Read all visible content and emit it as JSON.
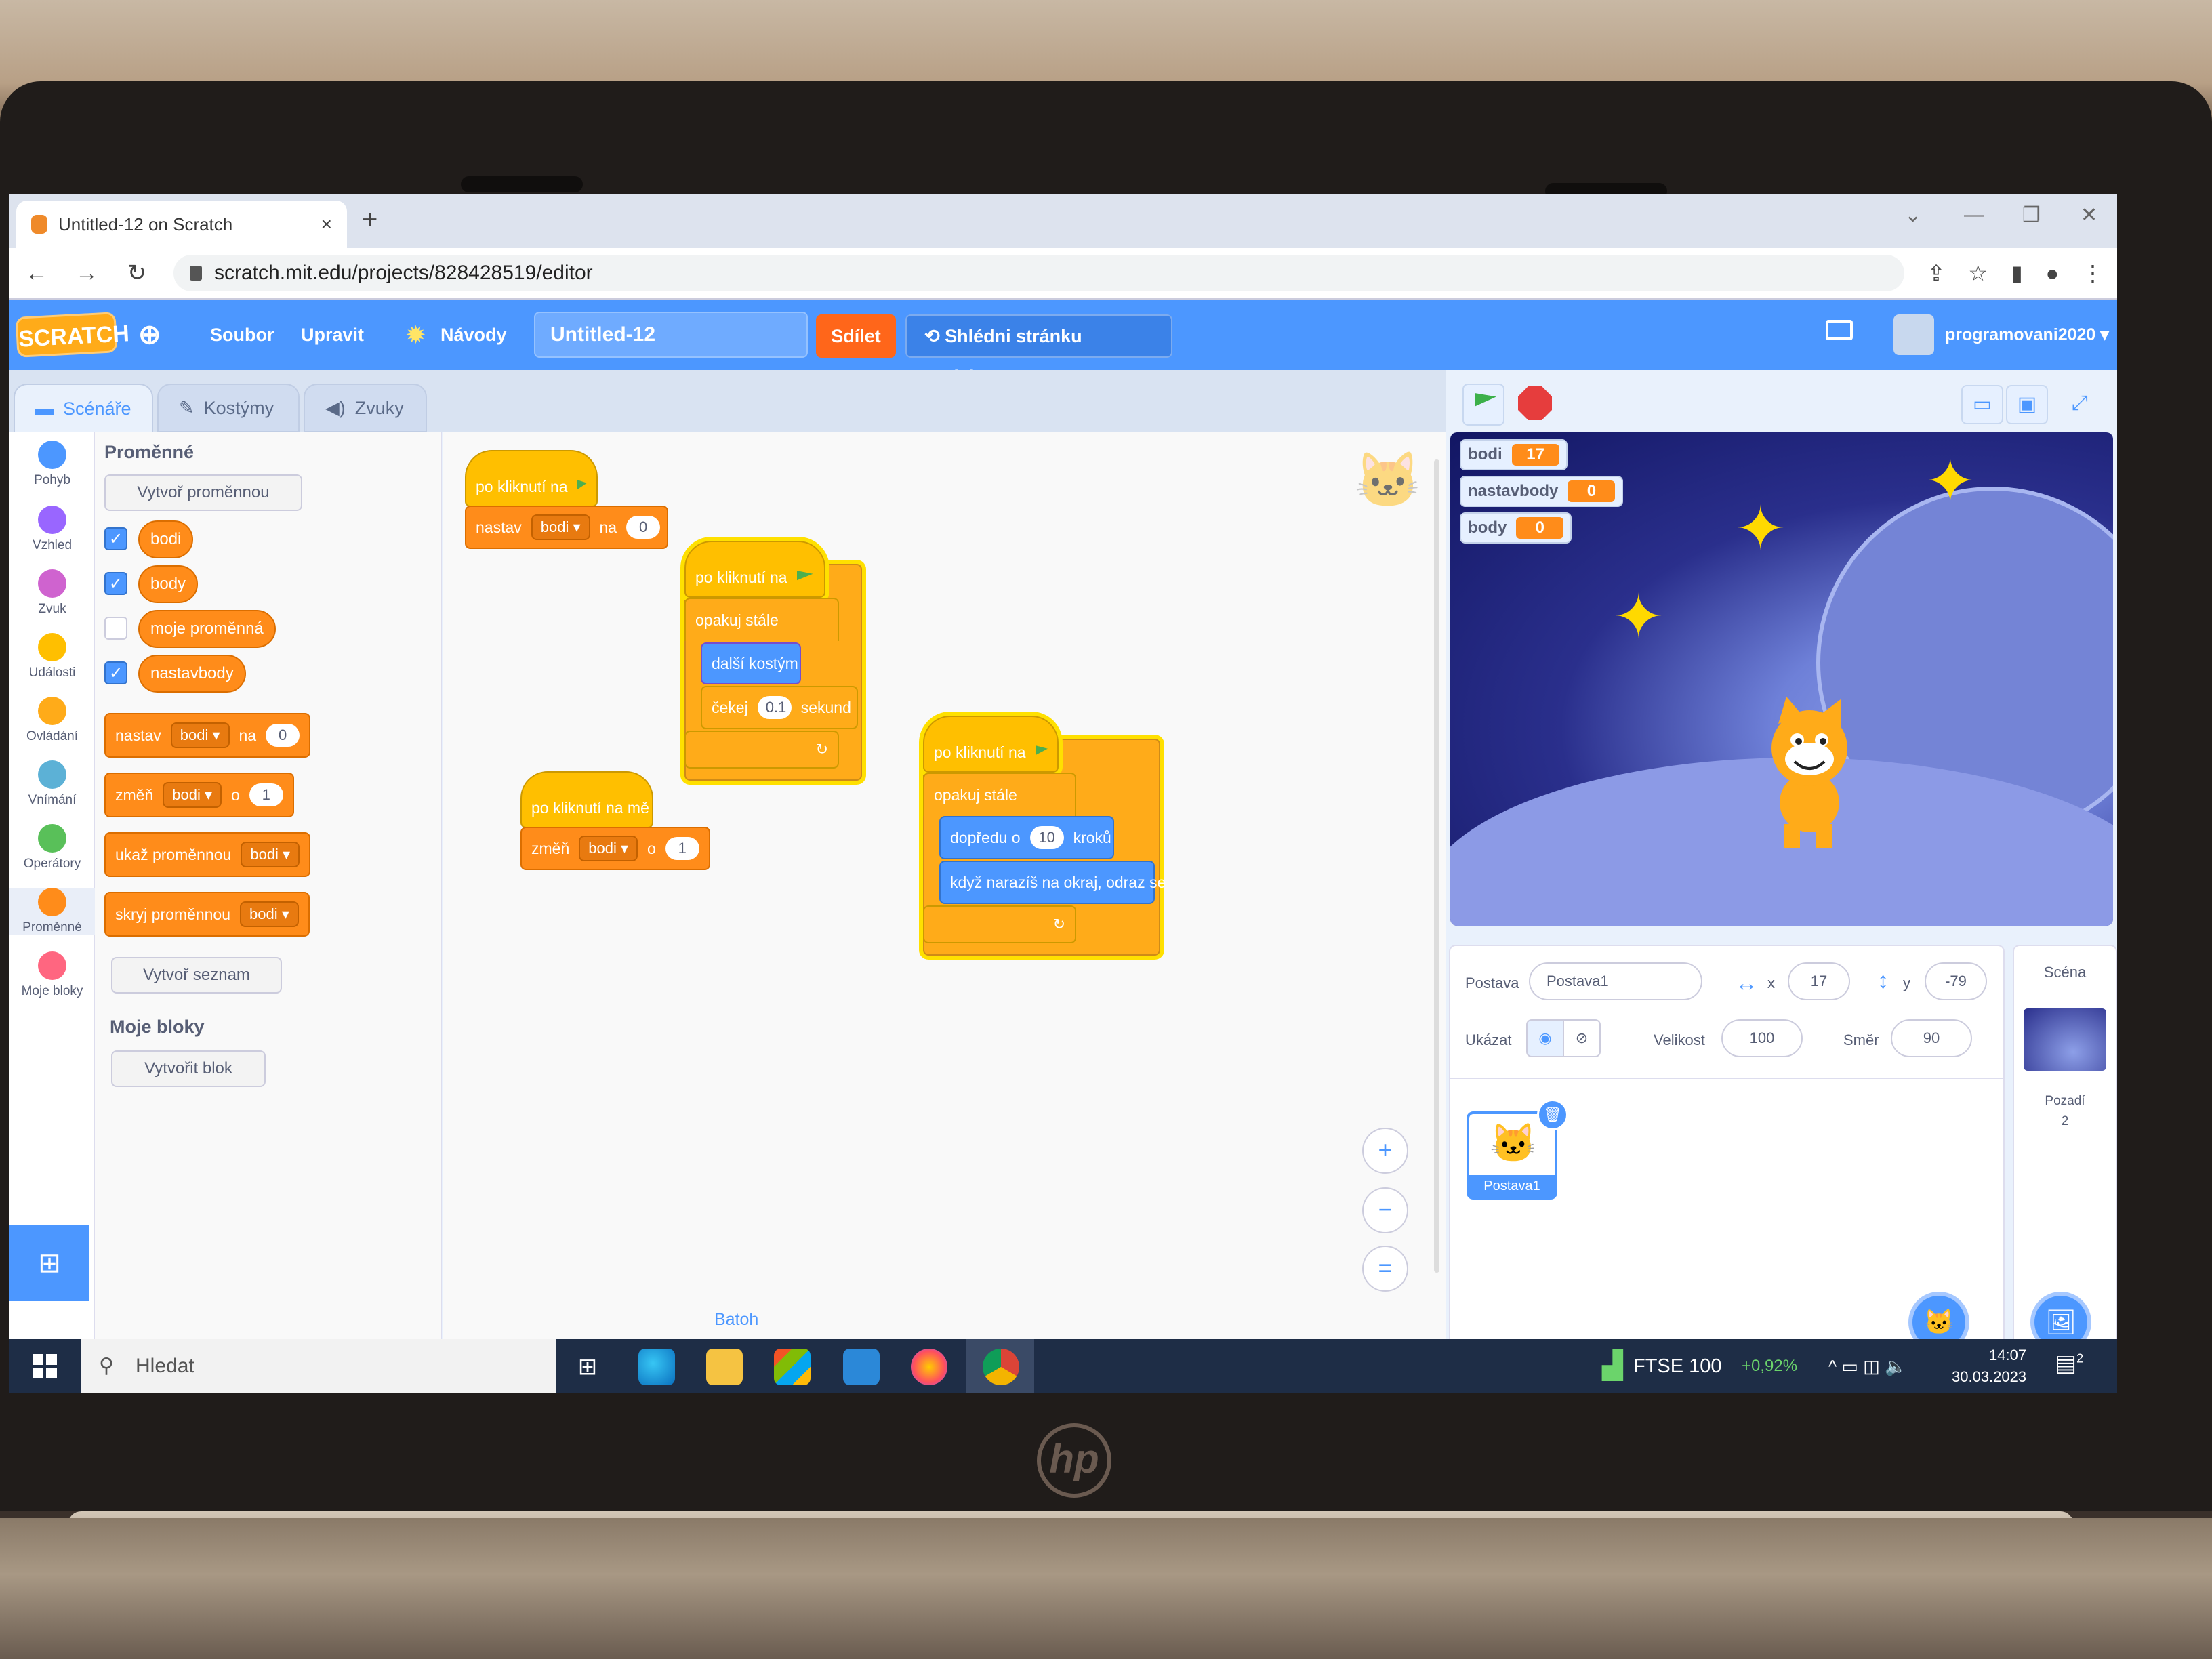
{
  "browser": {
    "tab_title": "Untitled-12 on Scratch",
    "tab_close": "×",
    "new_tab": "+",
    "window_controls": [
      "⌄",
      "—",
      "❐",
      "✕"
    ],
    "back": "←",
    "forward": "→",
    "reload": "↻",
    "url": "scratch.mit.edu/projects/828428519/editor",
    "toolbar_icons": [
      "share-icon",
      "star-icon",
      "side-panel-icon",
      "profile-icon",
      "kebab-menu-icon"
    ]
  },
  "menubar": {
    "logo": "SCRATCH",
    "language_icon": "globe-icon",
    "file": "Soubor",
    "edit": "Upravit",
    "tutorials": "Návody",
    "project_title": "Untitled-12",
    "share": "Sdílet",
    "see_project_page": "Shlédni stránku projektu",
    "username": "programovani2020",
    "colors": {
      "bar": "#4c97ff",
      "share": "#ff661a"
    }
  },
  "editor_tabs": [
    {
      "label": "Scénáře",
      "icon": "code-icon",
      "active": true
    },
    {
      "label": "Kostýmy",
      "icon": "brush-icon",
      "active": false
    },
    {
      "label": "Zvuky",
      "icon": "speaker-icon",
      "active": false
    }
  ],
  "categories": [
    {
      "label": "Pohyb",
      "color": "#4c97ff"
    },
    {
      "label": "Vzhled",
      "color": "#9966ff"
    },
    {
      "label": "Zvuk",
      "color": "#cf63cf"
    },
    {
      "label": "Události",
      "color": "#ffbf00"
    },
    {
      "label": "Ovládání",
      "color": "#ffab19"
    },
    {
      "label": "Vnímání",
      "color": "#5cb1d6"
    },
    {
      "label": "Operátory",
      "color": "#59c059"
    },
    {
      "label": "Proměnné",
      "color": "#ff8c1a"
    },
    {
      "label": "Moje bloky",
      "color": "#ff6680"
    }
  ],
  "palette": {
    "heading": "Proměnné",
    "make_variable": "Vytvoř proměnnou",
    "variables": [
      {
        "name": "bodi",
        "checked": true
      },
      {
        "name": "body",
        "checked": true
      },
      {
        "name": "moje proměnná",
        "checked": false
      },
      {
        "name": "nastavbody",
        "checked": true
      }
    ],
    "checkmark": "✓",
    "blocks": [
      {
        "parts": [
          "nastav",
          "bodi ▾",
          "na",
          "0"
        ]
      },
      {
        "parts": [
          "změň",
          "bodi ▾",
          "o",
          "1"
        ]
      },
      {
        "parts": [
          "ukaž proměnnou",
          "bodi ▾"
        ]
      },
      {
        "parts": [
          "skryj proměnnou",
          "bodi ▾"
        ]
      }
    ],
    "make_list": "Vytvoř seznam",
    "my_blocks_heading": "Moje bloky",
    "make_block": "Vytvořit blok",
    "extension_icon": "add-extension-icon"
  },
  "workspace": {
    "script1": {
      "hat": "po kliknutí na",
      "set": "nastav",
      "var": "bodi ▾",
      "to": "na",
      "value": "0"
    },
    "script2": {
      "hat": "po kliknutí na",
      "forever": "opakuj stále",
      "next_costume": "další kostým",
      "wait": "čekej",
      "wait_value": "0.1",
      "seconds": "sekund",
      "loop_arrow": "↻"
    },
    "script3": {
      "hat": "po kliknutí na mě",
      "change": "změň",
      "var": "bodi ▾",
      "by": "o",
      "value": "1"
    },
    "script4": {
      "hat": "po kliknutí na",
      "forever": "opakuj stále",
      "move": "dopředu o",
      "move_value": "10",
      "steps": "kroků",
      "bounce": "když narazíš na okraj, odraz se",
      "loop_arrow": "↻"
    },
    "zoom_in": "+",
    "zoom_out": "−",
    "zoom_reset": "=",
    "backpack": "Batoh"
  },
  "stage": {
    "monitors": [
      {
        "label": "bodi",
        "value": "17"
      },
      {
        "label": "nastavbody",
        "value": "0"
      },
      {
        "label": "body",
        "value": "0"
      }
    ],
    "small_stage_icon": "▭",
    "normal_stage_icon": "▣",
    "fullscreen_icon": "⤢",
    "star": "✦"
  },
  "sprite_info": {
    "sprite_label": "Postava",
    "sprite_name": "Postava1",
    "x_label": "x",
    "x": "17",
    "y_label": "y",
    "y": "-79",
    "show_label": "Ukázat",
    "size_label": "Velikost",
    "size": "100",
    "direction_label": "Směr",
    "direction": "90",
    "thumb_name": "Postava1",
    "delete": "🗑",
    "add_sprite": "🐱"
  },
  "scene_panel": {
    "title": "Scéna",
    "backdrops_label": "Pozadí",
    "backdrops_count": "2",
    "add_backdrop": "🖼"
  },
  "taskbar": {
    "search": "Hledat",
    "ticker": "FTSE 100",
    "ticker_change": "+0,92%",
    "time": "14:07",
    "date": "30.03.2023",
    "tray": "^ ▭ ◫ 🔈",
    "notifications": "2"
  },
  "laptop": {
    "brand": "hp"
  }
}
